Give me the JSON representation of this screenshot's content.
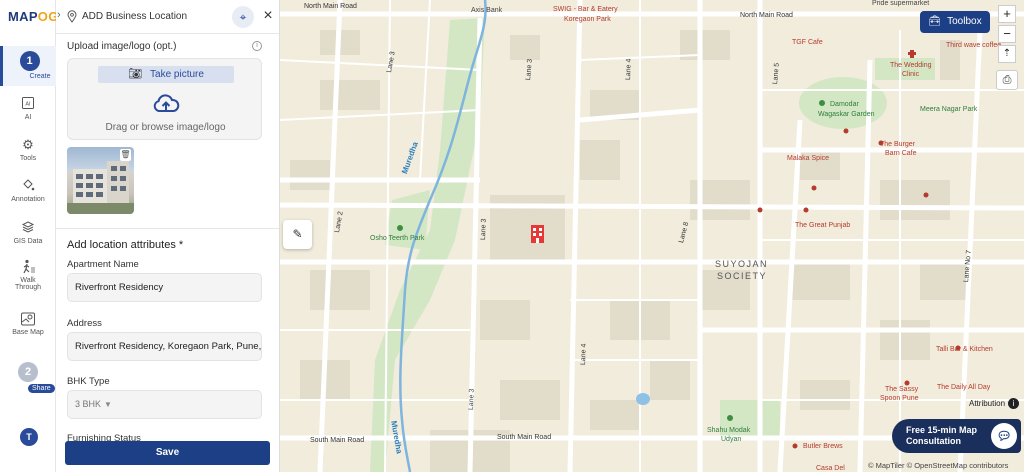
{
  "app": {
    "logo": "MAP",
    "logo_accent": "OG",
    "brand_color": "#1d3f85",
    "accent_color": "#f0a31c"
  },
  "rail": {
    "create": {
      "number": "1",
      "label": "Create"
    },
    "items": [
      {
        "label": "AI",
        "icon": "ai-icon"
      },
      {
        "label": "Tools",
        "icon": "gear-icon"
      },
      {
        "label": "Annotation",
        "icon": "paint-bucket-icon"
      },
      {
        "label": "GIS Data",
        "icon": "layers-icon"
      },
      {
        "label": "Walk",
        "label2": "Through",
        "icon": "walk-icon"
      },
      {
        "label": "Base Map",
        "icon": "map-icon"
      }
    ],
    "share": {
      "number": "2",
      "label": "Share"
    },
    "avatar": "T"
  },
  "panel": {
    "title": "ADD Business Location",
    "upload_label": "Upload image/logo (opt.)",
    "take_picture": "Take picture",
    "drag_text": "Drag or browse image/logo",
    "attrs_heading": "Add location attributes *",
    "fields": [
      {
        "label": "Apartment Name",
        "value": "Riverfront Residency"
      },
      {
        "label": "Address",
        "value": "Riverfront Residency, Koregaon Park, Pune,"
      },
      {
        "label": "BHK Type",
        "value": "3 BHK"
      }
    ],
    "furnishing_label": "Furnishing Status",
    "save": "Save"
  },
  "map": {
    "toolbox": "Toolbox",
    "attribution": "Attribution",
    "consult_line1": "Free 15-min Map",
    "consult_line2": "Consultation",
    "copyright": "© MapTiler © OpenStreetMap contributors",
    "labels": {
      "north_main_road": "North Main Road",
      "north_main_road2": "North Main Road",
      "axis_bank": "Axis Bank",
      "swig": "SWIG - Bar & Eatery",
      "koregaon_park": "Koregaon Park",
      "pride": "Pride supermarket",
      "tgf": "TGF Cafe",
      "third_wave": "Third wave coffee",
      "wedding_clinic": "The Wedding",
      "wedding_clinic2": "Clinic",
      "meera_nagar": "Meera Nagar Park",
      "damodar": "Damodar",
      "damodar2": "Wagaskar Garden",
      "burger_barn": "The Burger",
      "burger_barn2": "Barn Cafe",
      "malaka": "Malaka Spice",
      "great_punjab": "The Great Punjab",
      "osho": "Osho Teerth Park",
      "suyojan": "SUYOJAN",
      "society": "SOCIETY",
      "talli": "Talli Bar & Kitchen",
      "sassy": "The Sassy",
      "sassy2": "Spoon Pune",
      "daily_all_day": "The Daily All Day",
      "shahu": "Shahu Modak",
      "shahu2": "Udyan",
      "butler": "Butler Brews",
      "casa": "Casa Del",
      "south_main_road": "South Main Road",
      "south_main_road2": "South Main Road",
      "muredha": "Muredha",
      "muredha2": "Muredha",
      "lane2": "Lane 2",
      "lane3a": "Lane 3",
      "lane3b": "Lane 3",
      "lane3c": "Lane 3",
      "lane4a": "Lane 4",
      "lane4b": "Lane 4",
      "lane5": "Lane 5",
      "lane7": "Lane No 7",
      "lane8": "Lane 8"
    }
  }
}
